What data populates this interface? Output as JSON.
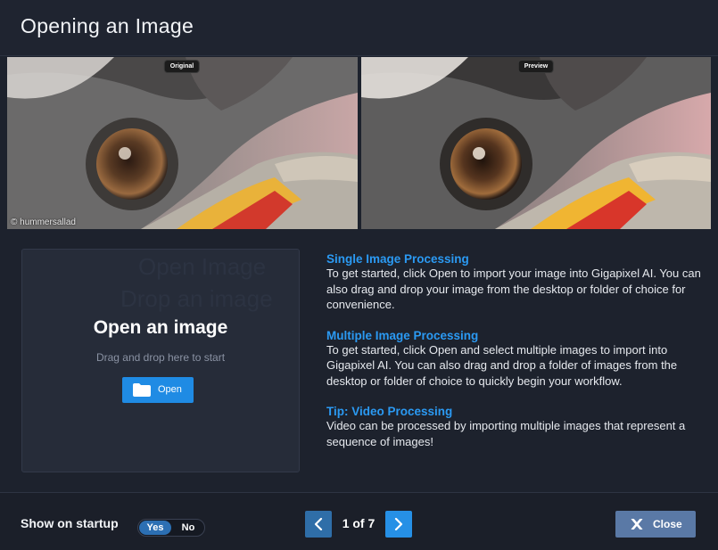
{
  "dialog": {
    "title": "Opening an Image"
  },
  "images": {
    "left_tag": "Original",
    "right_tag": "Preview",
    "watermark": "© hummersallad"
  },
  "open_card": {
    "heading": "Open an image",
    "subtext": "Drag and drop here to start",
    "button_label": "Open",
    "button_icon": "folder-icon",
    "ghost_line1": "Open Image",
    "ghost_line2": "Drop an image"
  },
  "info": [
    {
      "title": "Single Image Processing",
      "body": "To get started, click Open to import your image into Gigapixel AI. You can also drag and drop your image from the desktop or folder of choice for convenience."
    },
    {
      "title": "Multiple Image Processing",
      "body": "To get started, click Open and select multiple images to import into Gigapixel AI. You can also drag and drop a folder of images from the desktop or folder of choice to quickly begin your workflow."
    },
    {
      "title": "Tip: Video Processing",
      "body": "Video can be processed by importing multiple images that represent a sequence of images!"
    }
  ],
  "footer": {
    "startup_label": "Show on startup",
    "toggle_yes": "Yes",
    "toggle_no": "No",
    "toggle_selected": "Yes",
    "page_counter": "1 of 7",
    "close_label": "Close"
  },
  "colors": {
    "accent": "#2b9af3",
    "button_blue": "#1f8be4",
    "close_button": "#5a79a6",
    "background": "#1d222d"
  }
}
